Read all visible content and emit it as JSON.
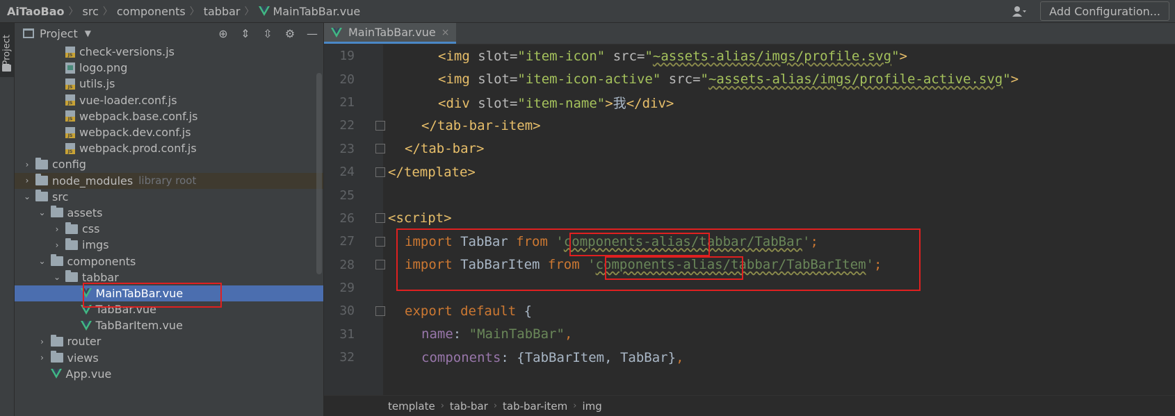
{
  "breadcrumb": [
    "AiTaoBao",
    "src",
    "components",
    "tabbar",
    "MainTabBar.vue"
  ],
  "top_right": {
    "user_icon": "user-icon",
    "add_config": "Add Configuration..."
  },
  "toolstrip": {
    "project_label": "Project"
  },
  "project_panel": {
    "title": "Project",
    "icons": [
      "locate-icon",
      "expand-all-icon",
      "collapse-all-icon",
      "gear-icon",
      "minimize-icon"
    ],
    "tree": [
      {
        "label": "check-versions.js",
        "type": "js",
        "indent": 3,
        "arrow": ""
      },
      {
        "label": "logo.png",
        "type": "png",
        "indent": 3,
        "arrow": ""
      },
      {
        "label": "utils.js",
        "type": "js",
        "indent": 3,
        "arrow": ""
      },
      {
        "label": "vue-loader.conf.js",
        "type": "js",
        "indent": 3,
        "arrow": ""
      },
      {
        "label": "webpack.base.conf.js",
        "type": "js",
        "indent": 3,
        "arrow": ""
      },
      {
        "label": "webpack.dev.conf.js",
        "type": "js",
        "indent": 3,
        "arrow": ""
      },
      {
        "label": "webpack.prod.conf.js",
        "type": "js",
        "indent": 3,
        "arrow": ""
      },
      {
        "label": "config",
        "type": "folder",
        "indent": 1,
        "arrow": "›"
      },
      {
        "label": "node_modules",
        "hint": "library root",
        "type": "folder",
        "indent": 1,
        "arrow": "›",
        "dim": true
      },
      {
        "label": "src",
        "type": "folder",
        "indent": 1,
        "arrow": "⌄"
      },
      {
        "label": "assets",
        "type": "folder",
        "indent": 2,
        "arrow": "⌄"
      },
      {
        "label": "css",
        "type": "folder",
        "indent": 3,
        "arrow": "›"
      },
      {
        "label": "imgs",
        "type": "folder",
        "indent": 3,
        "arrow": "›"
      },
      {
        "label": "components",
        "type": "folder",
        "indent": 2,
        "arrow": "⌄"
      },
      {
        "label": "tabbar",
        "type": "folder",
        "indent": 3,
        "arrow": "⌄"
      },
      {
        "label": "MainTabBar.vue",
        "type": "vue",
        "indent": 4,
        "arrow": "",
        "selected": true
      },
      {
        "label": "TabBar.vue",
        "type": "vue",
        "indent": 4,
        "arrow": ""
      },
      {
        "label": "TabBarItem.vue",
        "type": "vue",
        "indent": 4,
        "arrow": ""
      },
      {
        "label": "router",
        "type": "folder",
        "indent": 2,
        "arrow": "›"
      },
      {
        "label": "views",
        "type": "folder",
        "indent": 2,
        "arrow": "›"
      },
      {
        "label": "App.vue",
        "type": "vue",
        "indent": 2,
        "arrow": ""
      }
    ]
  },
  "editor": {
    "tab": {
      "label": "MainTabBar.vue",
      "close": "×"
    },
    "lines": [
      {
        "n": "19"
      },
      {
        "n": "20"
      },
      {
        "n": "21"
      },
      {
        "n": "22"
      },
      {
        "n": "23"
      },
      {
        "n": "24"
      },
      {
        "n": "25"
      },
      {
        "n": "26"
      },
      {
        "n": "27"
      },
      {
        "n": "28"
      },
      {
        "n": "29"
      },
      {
        "n": "30"
      },
      {
        "n": "31"
      },
      {
        "n": "32"
      }
    ],
    "code": {
      "l19_src": "~assets-alias/imgs/profile.svg",
      "l20_src": "~assets-alias/imgs/profile-active.svg",
      "l21_text": "我",
      "l27_path": "components-alias/tabbar/TabBar",
      "l28_path": "components-alias/tabbar/TabBarItem",
      "l31_name": "MainTabBar"
    },
    "status_crumbs": [
      "template",
      "tab-bar",
      "tab-bar-item",
      "img"
    ]
  },
  "colors": {
    "tag": "#e8bf6a",
    "keyword": "#cc7832",
    "string": "#6a8759",
    "selection": "#4b6eaf",
    "highlight_box": "#e02020"
  }
}
